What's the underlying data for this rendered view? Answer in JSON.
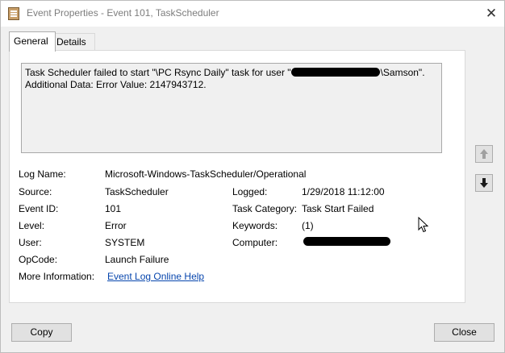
{
  "window": {
    "title": "Event Properties - Event 101, TaskScheduler",
    "close_glyph": "✕"
  },
  "tabs": [
    {
      "label": "General",
      "active": true
    },
    {
      "label": "Details",
      "active": false
    }
  ],
  "message": {
    "line1_before": "Task Scheduler failed to start \"\\PC Rsync Daily\" task for user \"",
    "line1_after": "\\Samson\".",
    "line2": "Additional Data: Error Value: 2147943712."
  },
  "fields": {
    "log_name": {
      "label": "Log Name:",
      "value": "Microsoft-Windows-TaskScheduler/Operational"
    },
    "source": {
      "label": "Source:",
      "value": "TaskScheduler"
    },
    "logged": {
      "label": "Logged:",
      "value": "1/29/2018 11:12:00"
    },
    "event_id": {
      "label": "Event ID:",
      "value": "101"
    },
    "task_category": {
      "label": "Task Category:",
      "value": "Task Start Failed"
    },
    "level": {
      "label": "Level:",
      "value": "Error"
    },
    "keywords": {
      "label": "Keywords:",
      "value": "(1)"
    },
    "user": {
      "label": "User:",
      "value": "SYSTEM"
    },
    "computer": {
      "label": "Computer:"
    },
    "opcode": {
      "label": "OpCode:",
      "value": "Launch Failure"
    },
    "more_info": {
      "label": "More Information:",
      "link": "Event Log Online Help"
    }
  },
  "buttons": {
    "copy": "Copy",
    "close": "Close"
  },
  "icons": {
    "up": "arrow-up-icon",
    "down": "arrow-down-icon"
  }
}
